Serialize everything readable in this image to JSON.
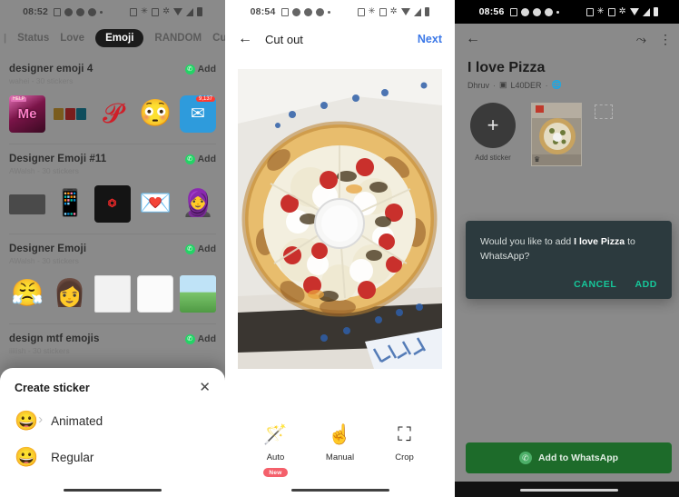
{
  "panel1": {
    "statusbar": {
      "time": "08:52",
      "icons": [
        "calendar-icon",
        "message-dot-icon",
        "message-dot-icon",
        "message-dot-icon",
        "dot-icon",
        "nfc-icon",
        "bluetooth-icon",
        "qr-icon",
        "mute-icon",
        "wifi-icon",
        "signal-icon",
        "battery-icon"
      ]
    },
    "tabs": {
      "leading": "|",
      "items": [
        "Status",
        "Love",
        "Emoji",
        "RANDOM",
        "Cute"
      ],
      "active": "Emoji"
    },
    "packs": [
      {
        "title": "designer emoji 4",
        "sub": "wahei - 30 stickers",
        "add_label": "Add"
      },
      {
        "title": "Designer Emoji #11",
        "sub": "AWalsh - 30 stickers",
        "add_label": "Add"
      },
      {
        "title": "Designer Emoji",
        "sub": "AWalsh - 30 stickers",
        "add_label": "Add"
      },
      {
        "title": "design mtf emojis",
        "sub": "iiiiish - 30 stickers",
        "add_label": "Add"
      }
    ],
    "sheet": {
      "title": "Create sticker",
      "close_icon": "close-icon",
      "options": [
        {
          "icon": "animated-smiley-icon",
          "label": "Animated"
        },
        {
          "icon": "smiley-icon",
          "label": "Regular"
        }
      ]
    }
  },
  "panel2": {
    "statusbar": {
      "time": "08:54"
    },
    "appbar": {
      "back_icon": "back-arrow-icon",
      "title": "Cut out",
      "next_label": "Next"
    },
    "photo": {
      "alt": "pizza-photo"
    },
    "tools": [
      {
        "icon": "magic-wand-icon",
        "label": "Auto",
        "badge": "New"
      },
      {
        "icon": "hand-pointer-icon",
        "label": "Manual",
        "badge": ""
      },
      {
        "icon": "crop-icon",
        "label": "Crop",
        "badge": ""
      }
    ]
  },
  "panel3": {
    "statusbar": {
      "time": "08:56"
    },
    "appbar": {
      "back_icon": "back-arrow-icon",
      "share_icon": "share-icon",
      "overflow_icon": "more-vertical-icon"
    },
    "title": "I love Pizza",
    "author": "Dhruv",
    "tray_label": "L40DER",
    "add_sticker": {
      "icon": "plus-icon",
      "label": "Add sticker"
    },
    "dialog": {
      "text_before": "Would you like to add ",
      "text_bold": "I love Pizza",
      "text_after": " to WhatsApp?",
      "cancel_label": "CANCEL",
      "add_label": "ADD"
    },
    "primary_button": {
      "icon": "whatsapp-icon",
      "label": "Add to WhatsApp"
    }
  },
  "colors": {
    "accent_blue": "#3b78e7",
    "whatsapp_green": "#25D366",
    "button_green": "#1d6b2a",
    "dialog_bg": "#2c3a3e",
    "dialog_action": "#16c79a",
    "badge_red": "#f4606b"
  }
}
